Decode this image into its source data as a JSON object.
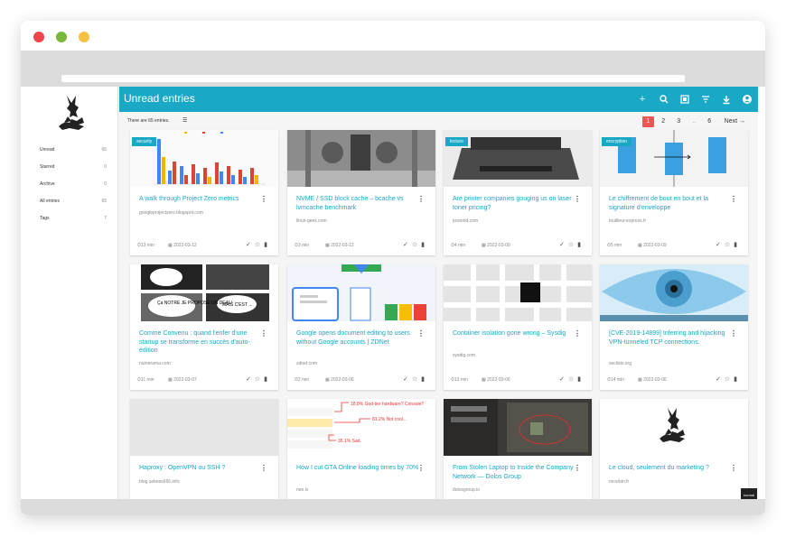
{
  "app": {
    "page_title": "Unread entries",
    "entries_text": "There are 65 entries.",
    "pagination": [
      "1",
      "2",
      "3",
      "..",
      "6"
    ],
    "next_label": "Next →",
    "mode_badge": "normal"
  },
  "sidebar": {
    "items": [
      {
        "label": "Unread",
        "count": "65"
      },
      {
        "label": "Starred",
        "count": "0"
      },
      {
        "label": "Archive",
        "count": "0"
      },
      {
        "label": "All entries",
        "count": "65"
      },
      {
        "label": "Tags",
        "count": "7"
      }
    ]
  },
  "toolbar_icons": [
    "add-icon",
    "search-icon",
    "theme-icon",
    "filter-icon",
    "download-icon",
    "account-icon"
  ],
  "accent_color": "#19a8c6",
  "cards": [
    {
      "tag": "security",
      "title": "A walk through Project Zero metrics",
      "domain": "googleprojectzero.blogspot.com",
      "time": "13 min",
      "date": "2022-03-12"
    },
    {
      "tag": "",
      "title": "NVME / SSD block cache – bcache vs lvmcache benchmark",
      "domain": "linux-geex.com",
      "time": "3 min",
      "date": "2022-03-12"
    },
    {
      "tag": "lecture",
      "title": "Are printer companies gouging us on laser toner pricing?",
      "domain": "pcworld.com",
      "time": "4 min",
      "date": "2022-03-09"
    },
    {
      "tag": "encryption",
      "title": "Le chiffrement de bout en bout et la signature d'enveloppe",
      "domain": "touilleur-express.fr",
      "time": "5 min",
      "date": "2022-03-09"
    },
    {
      "tag": "",
      "title": "Comme Convenu : quand l'enfer d'une startup se transforme en succès d'auto-édition",
      "domain": "numerama.com",
      "time": "11 min",
      "date": "2022-03-07"
    },
    {
      "tag": "",
      "title": "Google opens document editing to users without Google accounts | ZDNet",
      "domain": "zdnet.com",
      "time": "2 min",
      "date": "2022-03-06"
    },
    {
      "tag": "",
      "title": "Container isolation gone wrong – Sysdig",
      "domain": "sysdig.com",
      "time": "13 min",
      "date": "2022-03-06"
    },
    {
      "tag": "",
      "title": "[CVE-2019-14899] Inferring and hijacking VPN-tunneled TCP connections.",
      "domain": "seclists.org",
      "time": "14 min",
      "date": "2022-03-06"
    },
    {
      "tag": "",
      "title": "Haproxy : OpenVPN ou SSH ?",
      "domain": "blog.seboss666.info",
      "time": "",
      "date": ""
    },
    {
      "tag": "",
      "title": "How I cut GTA Online loading times by 70%",
      "domain": "nee.lv",
      "time": "",
      "date": ""
    },
    {
      "tag": "",
      "title": "From Stolen Laptop to Inside the Company Network — Dolos Group",
      "domain": "dolosgroup.io",
      "time": "",
      "date": ""
    },
    {
      "tag": "",
      "title": "Le cloud, seulement du marketing ?",
      "domain": "mcorbin.fr",
      "time": "",
      "date": ""
    }
  ],
  "thumb_text": {
    "comic_1": "Ça NOTRE JE PROPOSE UN DEAL!",
    "comic_2": "MAIS C'EST ...",
    "gta_1": "18.8% God-tier hardware? Console?",
    "gta_2": "81.2% Not cool...",
    "gta_3": "35.1% Sad."
  }
}
